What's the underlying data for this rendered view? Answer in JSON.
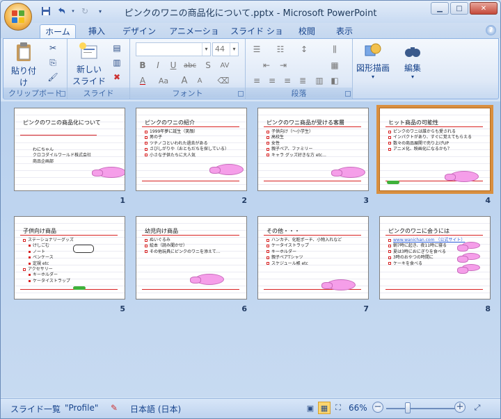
{
  "window": {
    "title": "ピンクのワニの商品化について.pptx - Microsoft PowerPoint"
  },
  "qat": {
    "icons": [
      "save-icon",
      "undo-icon",
      "redo-icon",
      "customize-icon"
    ]
  },
  "tabs": [
    {
      "label": "ホーム",
      "active": true
    },
    {
      "label": "挿入"
    },
    {
      "label": "デザイン"
    },
    {
      "label": "アニメーション"
    },
    {
      "label": "スライド ショー"
    },
    {
      "label": "校閲"
    },
    {
      "label": "表示"
    }
  ],
  "ribbon": {
    "clipboard": {
      "label": "クリップボード",
      "paste": "貼り付け"
    },
    "slides": {
      "label": "スライド",
      "new_slide_line1": "新しい",
      "new_slide_line2": "スライド"
    },
    "font": {
      "label": "フォント",
      "size": "44",
      "bold": "B",
      "italic": "I",
      "underline": "U",
      "strike": "abc",
      "shadow": "S",
      "spacing": "AV",
      "fontcolor": "A",
      "case": "Aa",
      "grow": "A",
      "shrink": "A"
    },
    "paragraph": {
      "label": "段落"
    },
    "drawing": {
      "label": "図形描画"
    },
    "editing": {
      "label": "編集"
    }
  },
  "slides": [
    {
      "number": "1",
      "title": "ピンクのワニの商品化について",
      "bullets": [
        "わにちゃん",
        "クロコダイルワールド株式会社",
        "商品企画部"
      ]
    },
    {
      "number": "2",
      "title": "ピンクのワニの紹介",
      "bullets": [
        "1999年夢に誕生（笑顔）",
        "男の子",
        "ツチノコといわれた過去がある",
        "さびしがりや（おともだちを探している）",
        "小さな子供たちに大人気"
      ]
    },
    {
      "number": "3",
      "title": "ピンクのワニ商品が受ける客層",
      "bullets": [
        "子供向け（～小学生）",
        "高校生",
        "女性",
        "親子ペア、ファミリー",
        "キャラ グッズ好きな方 etc..."
      ]
    },
    {
      "number": "4",
      "title": "ヒット商品の可能性",
      "bullets": [
        "ピンクのワニは誰からも愛される",
        "インパクトがあり、すぐに覚えてもらえる",
        "数々の商品展開で売り上げUP",
        "アニメ化、映画化になるかも？"
      ]
    },
    {
      "number": "5",
      "title": "子供向け商品",
      "bullets": [
        "ステーショナリーグッズ",
        "けしごむ",
        "ノート",
        "ペンケース",
        "定規 etc",
        "アクセサリー",
        "キーホルダー",
        "ケータイストラップ"
      ]
    },
    {
      "number": "6",
      "title": "幼児向け商品",
      "bullets": [
        "ぬいぐるみ",
        "絵本（読み聞かせ）",
        "その他玩具にピンクのワニを添えて…"
      ]
    },
    {
      "number": "7",
      "title": "その他・・・",
      "bullets": [
        "ハンカチ、化粧ポーチ、小物入れなど",
        "ケータイストラップ",
        "キーホルダー",
        "親子ペアTシャツ",
        "スケジュール帳 etc"
      ]
    },
    {
      "number": "8",
      "title": "ピンクのワニに会うには",
      "bullets": [
        "www.wanichan.com （公式サイト）",
        "朝7時に起き、夜11時に寝る",
        "夏は3時におにぎりを食べる",
        "3時のおやつの時間に",
        "ケーキを食べる"
      ]
    }
  ],
  "statusbar": {
    "view": "スライド一覧",
    "theme": "\"Profile\"",
    "language": "日本語 (日本)",
    "zoom": "66%",
    "zoom_fraction": 0.66
  }
}
